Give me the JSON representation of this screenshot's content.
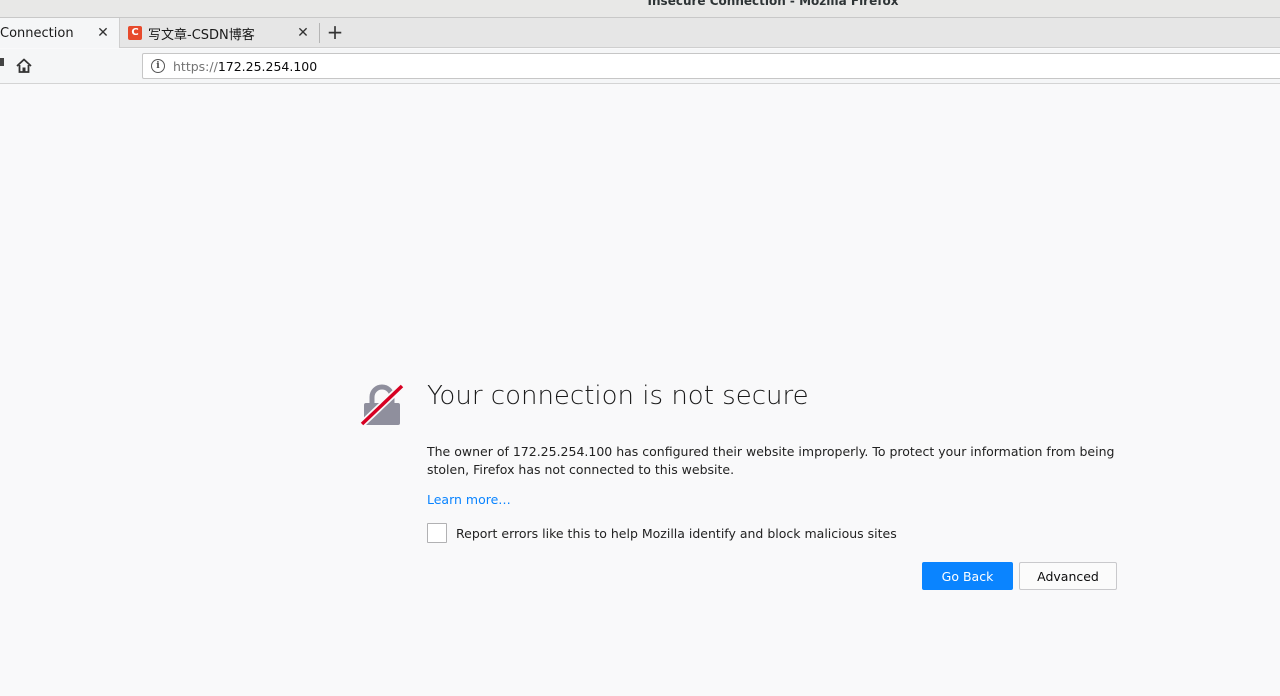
{
  "window": {
    "title": "Insecure Connection - Mozilla Firefox"
  },
  "tabs": [
    {
      "label": "Connection",
      "active": true
    },
    {
      "label": "写文章-CSDN博客",
      "active": false,
      "favicon_letter": "C",
      "favicon_color": "#e74a2c"
    }
  ],
  "navbar": {
    "url_scheme": "https://",
    "url_host": "172.25.254.100"
  },
  "error": {
    "title": "Your connection is not secure",
    "description": "The owner of 172.25.254.100 has configured their website improperly. To protect your information from being stolen, Firefox has not connected to this website.",
    "learn_more": "Learn more…",
    "report_label": "Report errors like this to help Mozilla identify and block malicious sites",
    "report_checked": false
  },
  "buttons": {
    "go_back": "Go Back",
    "advanced": "Advanced"
  },
  "colors": {
    "accent": "#0a84ff",
    "page_bg": "#f9f9fa",
    "warning_slash": "#d70022"
  },
  "icons": {
    "tab_close": "close-icon",
    "new_tab": "plus-icon",
    "home": "home-icon",
    "site_info": "info-icon",
    "error": "broken-lock-icon"
  }
}
